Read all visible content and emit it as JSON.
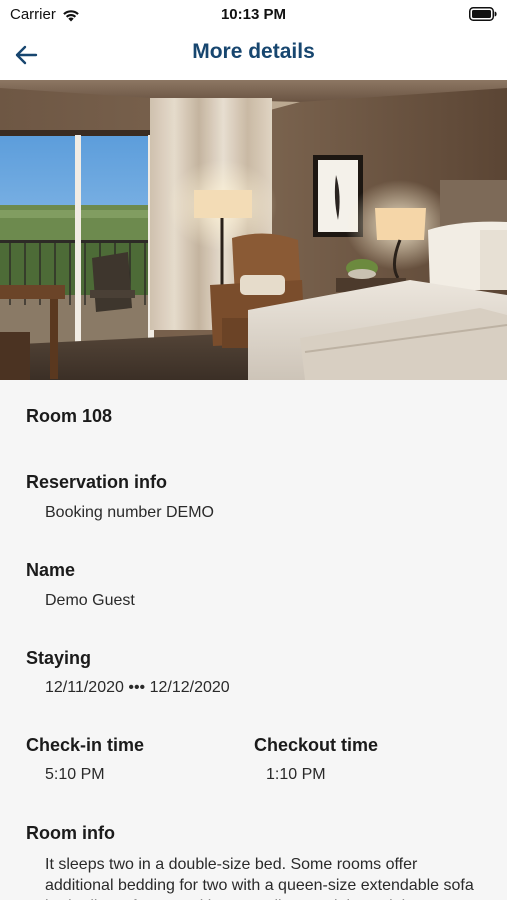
{
  "status_bar": {
    "carrier": "Carrier",
    "time": "10:13 PM"
  },
  "nav": {
    "title": "More details",
    "title_color": "#17466f"
  },
  "room": {
    "title": "Room 108"
  },
  "reservation": {
    "label": "Reservation info",
    "value": "Booking number DEMO"
  },
  "guest": {
    "label": "Name",
    "value": "Demo Guest"
  },
  "staying": {
    "label": "Staying",
    "value": "12/11/2020 ••• 12/12/2020"
  },
  "checkin": {
    "label": "Check-in time",
    "value": "5:10 PM"
  },
  "checkout": {
    "label": "Checkout time",
    "value": "1:10 PM"
  },
  "room_info": {
    "label": "Room info",
    "value": "It sleeps two in a double-size bed. Some rooms offer additional bedding for two with a queen-size extendable sofa bed. All comfort amenities as well as a mini-snack bar."
  },
  "icons": {
    "back": "arrow-left-icon",
    "wifi": "wifi-icon",
    "battery": "battery-icon"
  }
}
